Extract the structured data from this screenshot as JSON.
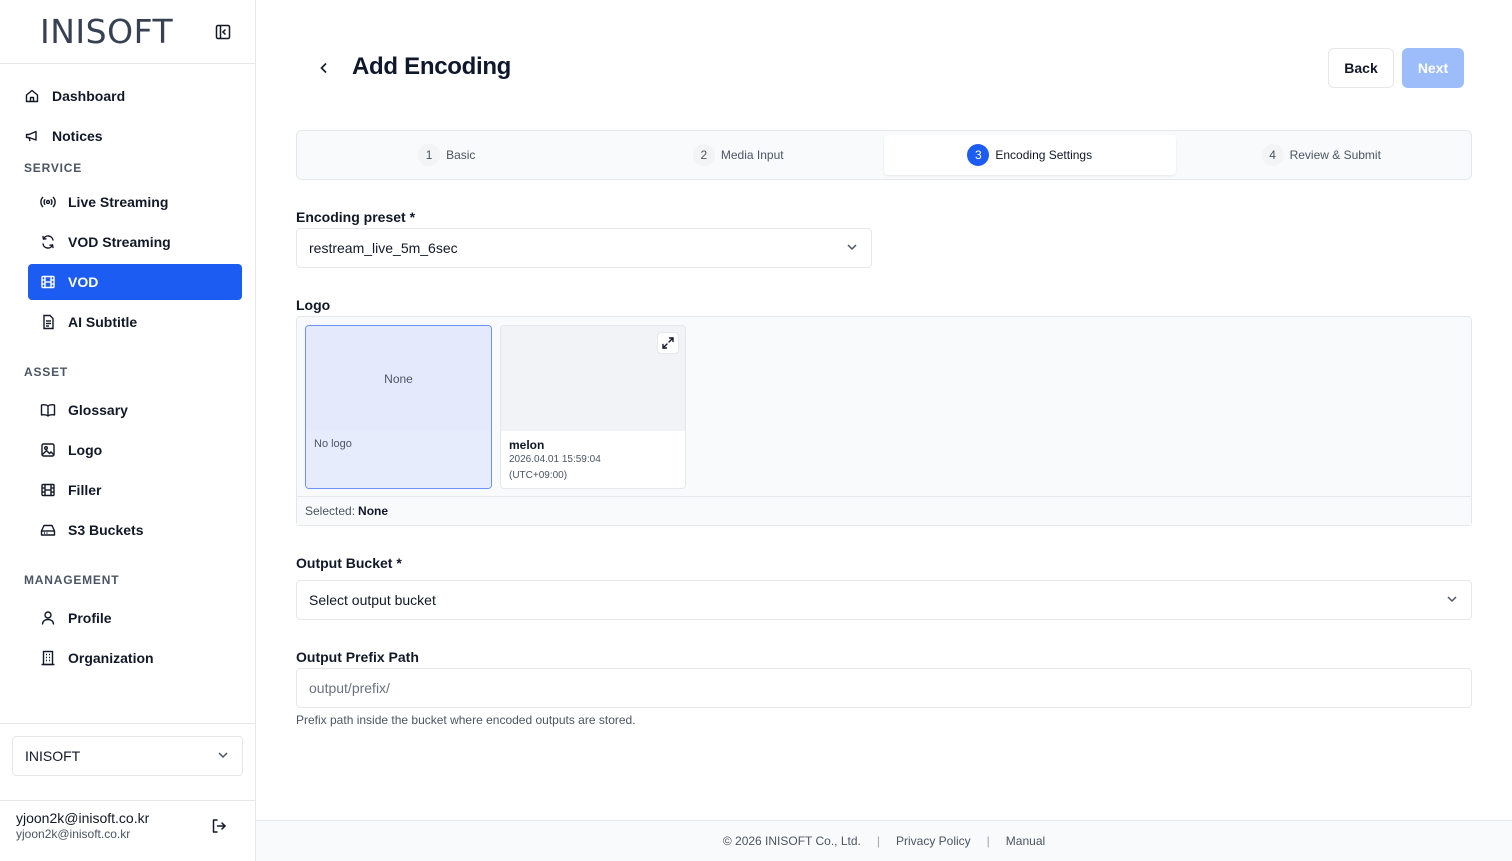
{
  "brand": {
    "name": "INISOFT"
  },
  "sidebar": {
    "top_items": [
      {
        "label": "Dashboard",
        "icon": "home-icon"
      },
      {
        "label": "Notices",
        "icon": "megaphone-icon"
      }
    ],
    "sections": [
      {
        "title": "SERVICE",
        "items": [
          {
            "label": "Live Streaming",
            "icon": "broadcast-icon"
          },
          {
            "label": "VOD Streaming",
            "icon": "refresh-icon"
          },
          {
            "label": "VOD",
            "icon": "film-icon",
            "active": true
          },
          {
            "label": "AI Subtitle",
            "icon": "document-icon"
          }
        ]
      },
      {
        "title": "ASSET",
        "items": [
          {
            "label": "Glossary",
            "icon": "book-icon"
          },
          {
            "label": "Logo",
            "icon": "image-icon"
          },
          {
            "label": "Filler",
            "icon": "film-icon"
          },
          {
            "label": "S3 Buckets",
            "icon": "hard-drive-icon"
          }
        ]
      },
      {
        "title": "MANAGEMENT",
        "items": [
          {
            "label": "Profile",
            "icon": "user-icon"
          },
          {
            "label": "Organization",
            "icon": "building-icon"
          }
        ]
      }
    ],
    "org_select": "INISOFT",
    "user": {
      "name": "yjoon2k@inisoft.co.kr",
      "email": "yjoon2k@inisoft.co.kr"
    }
  },
  "header": {
    "title": "Add Encoding",
    "back_label": "Back",
    "next_label": "Next"
  },
  "steps": [
    {
      "num": "1",
      "label": "Basic"
    },
    {
      "num": "2",
      "label": "Media Input"
    },
    {
      "num": "3",
      "label": "Encoding Settings",
      "active": true
    },
    {
      "num": "4",
      "label": "Review & Submit"
    }
  ],
  "form": {
    "preset_label": "Encoding preset *",
    "preset_value": "restream_live_5m_6sec",
    "logo_label": "Logo",
    "logo_cards": [
      {
        "thumb_text": "None",
        "caption": "No logo",
        "selected": true
      },
      {
        "title": "melon",
        "date": "2026.04.01 15:59:04",
        "tz": "(UTC+09:00)"
      }
    ],
    "selected_prefix": "Selected:",
    "selected_value": "None",
    "bucket_label": "Output Bucket *",
    "bucket_value": "Select output bucket",
    "prefix_label": "Output Prefix Path",
    "prefix_placeholder": "output/prefix/",
    "prefix_hint": "Prefix path inside the bucket where encoded outputs are stored."
  },
  "footer": {
    "copyright": "© 2026 INISOFT Co., Ltd.",
    "privacy": "Privacy Policy",
    "manual": "Manual"
  },
  "colors": {
    "accent": "#1d5cf2",
    "next_disabled": "#9cbcfa",
    "border": "#e5e7eb"
  }
}
